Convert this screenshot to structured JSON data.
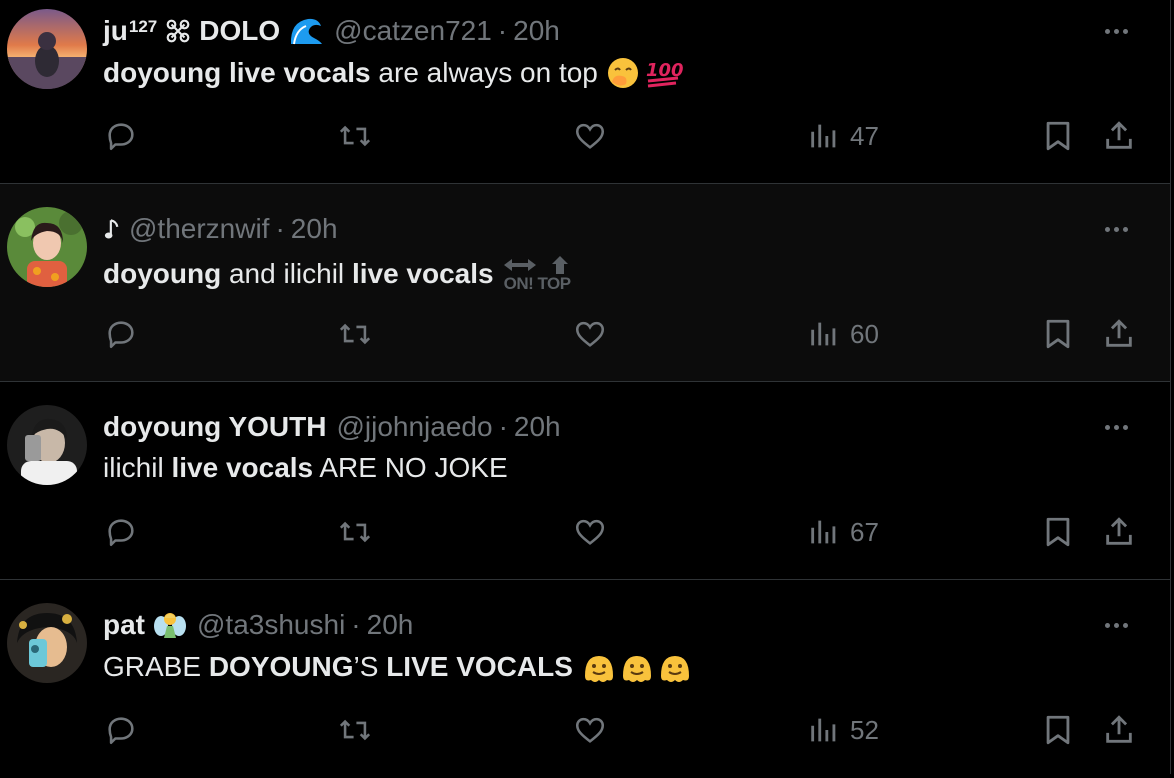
{
  "tweets": [
    {
      "name": "ju",
      "name_sup": "127",
      "name_suffix": "DOLO",
      "handle": "@catzen721",
      "dot": "·",
      "time": "20h",
      "text_parts": [
        {
          "bold": true,
          "text": "doyoung live vocals"
        },
        {
          "bold": false,
          "text": " are always on top"
        }
      ],
      "views": "47",
      "icons": [
        "knot-icon",
        "wave-emoji",
        "face-with-hand-emoji",
        "hundred-points-emoji"
      ],
      "avatar_colors": [
        "#d8704a",
        "#5a3c5c",
        "#f2b48a"
      ]
    },
    {
      "name": "",
      "name_prefix_icon": "music-note-icon",
      "handle": "@therznwif",
      "dot": "·",
      "time": "20h",
      "text_parts": [
        {
          "bold": true,
          "text": "doyoung"
        },
        {
          "bold": false,
          "text": " and ilichil "
        },
        {
          "bold": true,
          "text": "live vocals"
        }
      ],
      "emoji_text": "ON! TOP",
      "views": "60",
      "icons": [
        "on-top-emoji"
      ],
      "avatar_colors": [
        "#6aa04a",
        "#d0503a",
        "#f0c8b0"
      ]
    },
    {
      "name": "doyoung YOUTH",
      "handle": "@jjohnjaedo",
      "dot": "·",
      "time": "20h",
      "text_parts": [
        {
          "bold": false,
          "text": "ilichil "
        },
        {
          "bold": true,
          "text": "live vocals"
        },
        {
          "bold": false,
          "text": " ARE NO JOKE"
        }
      ],
      "views": "67",
      "avatar_colors": [
        "#3a3a3a",
        "#c8c8c8",
        "#707070"
      ]
    },
    {
      "name": "pat",
      "handle": "@ta3shushi",
      "dot": "·",
      "time": "20h",
      "text_parts": [
        {
          "bold": false,
          "text": "GRABE "
        },
        {
          "bold": true,
          "text": "DOYOUNG"
        },
        {
          "bold": false,
          "text": "’S "
        },
        {
          "bold": true,
          "text": "LIVE VOCALS"
        }
      ],
      "views": "52",
      "icons": [
        "fairy-emoji",
        "melting-face-emoji"
      ],
      "avatar_colors": [
        "#2a2a2a",
        "#e0b080",
        "#6cc8d8"
      ]
    }
  ],
  "colors": {
    "background": "#000000",
    "text": "#e7e9ea",
    "muted": "#71767b",
    "border": "#2f3336",
    "wave": "#1d9bf0",
    "hundred": "#e0245e"
  }
}
